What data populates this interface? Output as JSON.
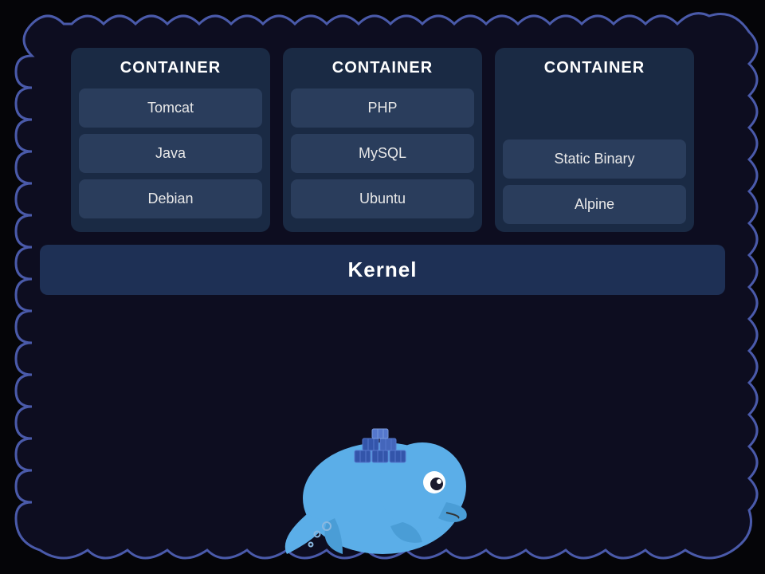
{
  "containers": [
    {
      "label": "CONTAINER",
      "items": [
        "Tomcat",
        "Java",
        "Debian"
      ]
    },
    {
      "label": "CONTAINER",
      "items": [
        "PHP",
        "MySQL",
        "Ubuntu"
      ]
    },
    {
      "label": "CONTAINER",
      "items": [
        "",
        "Static Binary",
        "Alpine"
      ]
    }
  ],
  "kernel": {
    "label": "Kernel"
  }
}
